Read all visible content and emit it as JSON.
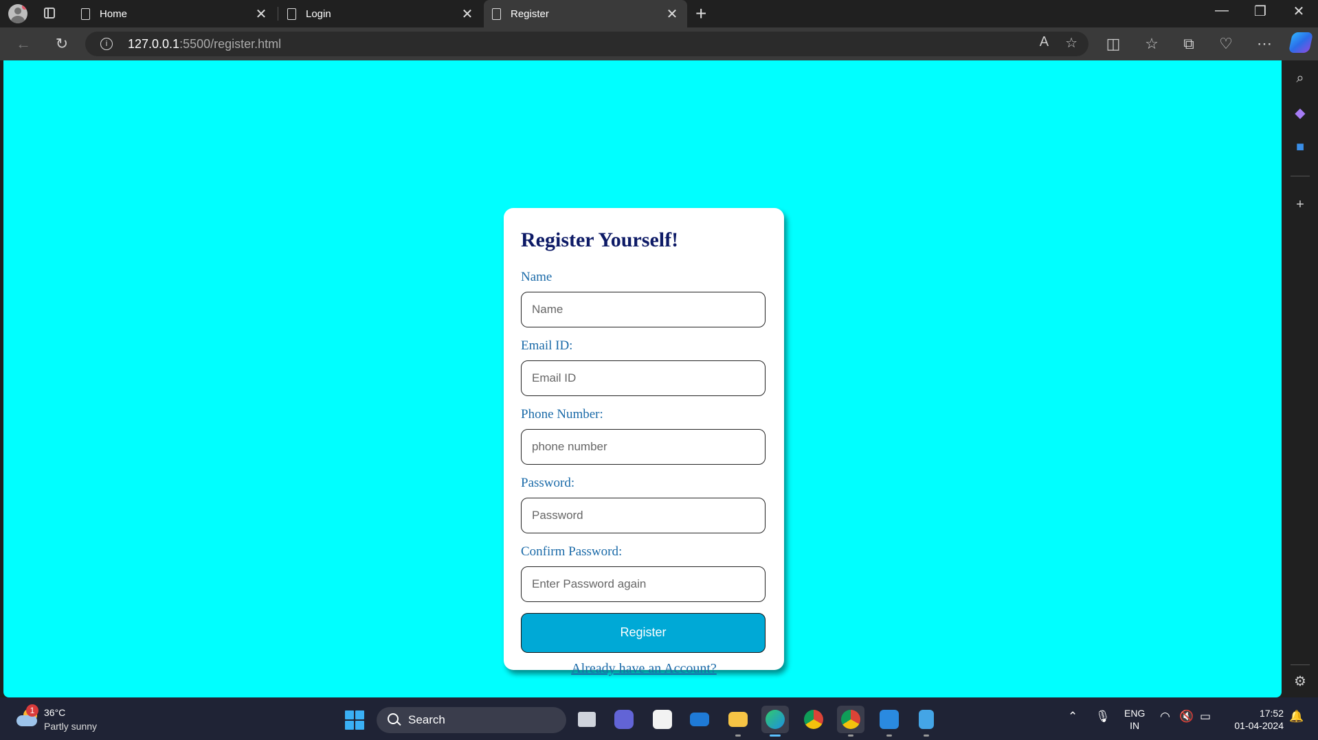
{
  "browser": {
    "tabs": [
      {
        "title": "Home",
        "close": "✕"
      },
      {
        "title": "Login",
        "close": "✕"
      },
      {
        "title": "Register",
        "close": "✕"
      }
    ],
    "new_tab": "+",
    "address": {
      "host": "127.0.0.1",
      "path": ":5500/register.html"
    },
    "window_controls": {
      "minimize": "—",
      "restore": "❐",
      "close": "✕"
    }
  },
  "page": {
    "title": "Register Yourself!",
    "fields": [
      {
        "label": "Name",
        "placeholder": "Name"
      },
      {
        "label": "Email ID:",
        "placeholder": "Email ID"
      },
      {
        "label": "Phone Number:",
        "placeholder": "phone number"
      },
      {
        "label": "Password:",
        "placeholder": "Password"
      },
      {
        "label": "Confirm Password:",
        "placeholder": "Enter Password again"
      }
    ],
    "register_button": "Register",
    "login_link": "Already have an Account?",
    "background_color": "#00ffff",
    "title_color": "#0d1a66",
    "label_color": "#1a6aa8",
    "button_color": "#00a9d6"
  },
  "taskbar": {
    "weather": {
      "temp": "36°C",
      "desc": "Partly sunny",
      "badge": "1"
    },
    "search_label": "Search",
    "language": {
      "line1": "ENG",
      "line2": "IN"
    },
    "clock": {
      "time": "17:52",
      "date": "01-04-2024"
    }
  }
}
